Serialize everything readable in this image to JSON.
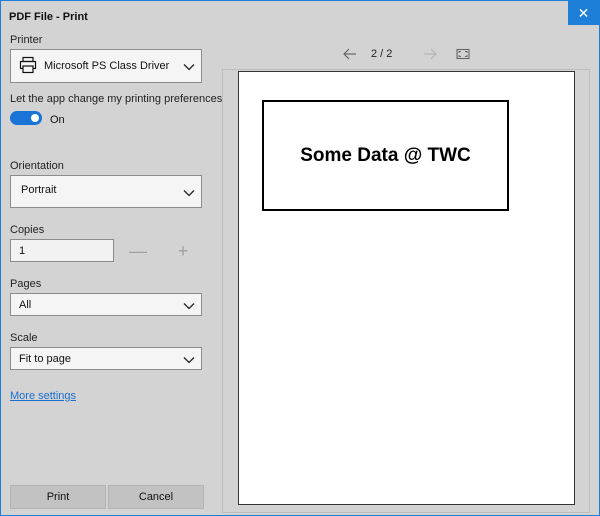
{
  "window": {
    "title": "PDF File - Print",
    "close_glyph": "✕"
  },
  "printer": {
    "label": "Printer",
    "value": "Microsoft PS Class Driver",
    "icon": "printer-icon"
  },
  "preferences": {
    "label": "Let the app change my printing preferences",
    "toggle_state": "On",
    "enabled": true
  },
  "orientation": {
    "label": "Orientation",
    "value": "Portrait"
  },
  "copies": {
    "label": "Copies",
    "value": "1",
    "decrement_glyph": "—",
    "increment_glyph": "+"
  },
  "pages": {
    "label": "Pages",
    "value": "All"
  },
  "scale": {
    "label": "Scale",
    "value": "Fit to page"
  },
  "more_settings": "More settings",
  "buttons": {
    "print": "Print",
    "cancel": "Cancel"
  },
  "preview": {
    "current_page": "2",
    "total_pages": "2",
    "page_indicator": "2 / 2",
    "content_text": "Some Data @ TWC"
  },
  "colors": {
    "accent": "#1a73d6",
    "close_bg": "#1e7fd9",
    "link": "#1a6fd0",
    "panel_bg": "#d3d3d3"
  }
}
